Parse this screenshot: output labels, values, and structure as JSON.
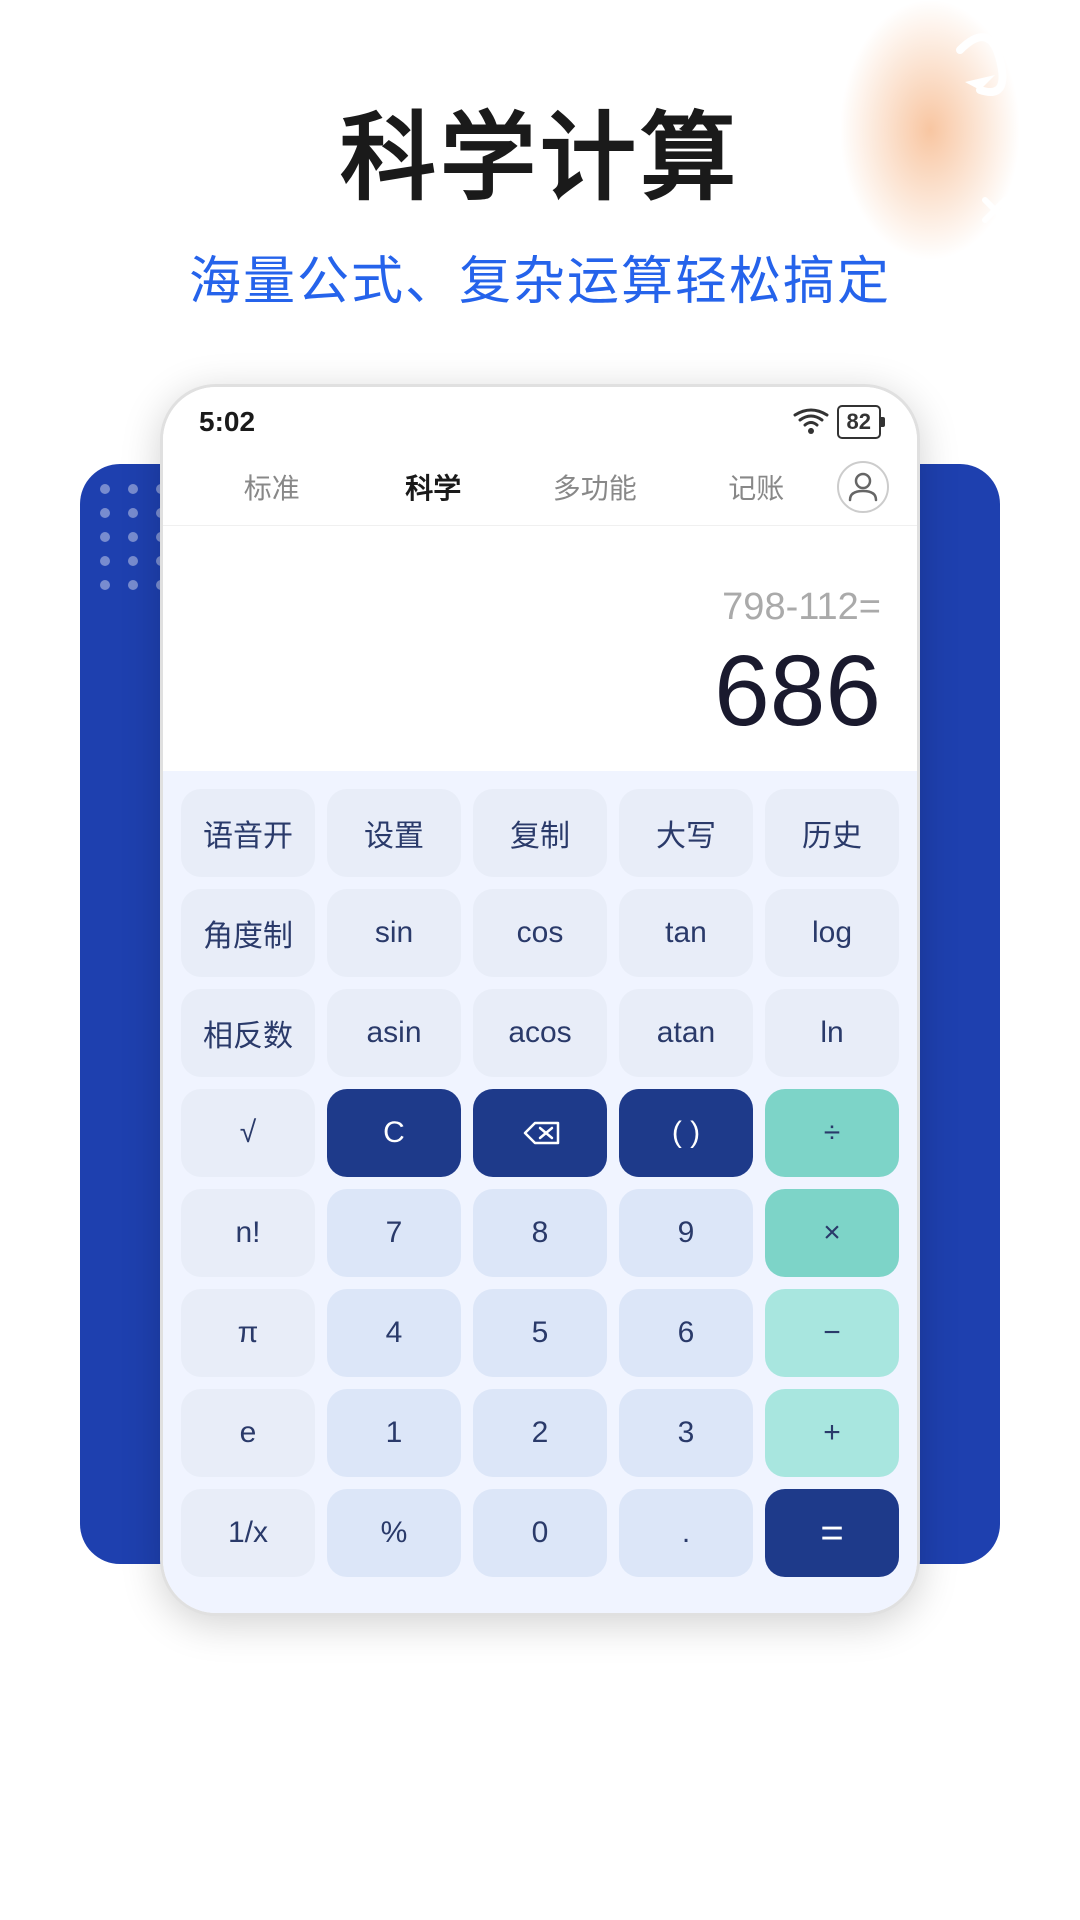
{
  "page": {
    "title": "科学计算",
    "subtitle": "海量公式、复杂运算轻松搞定"
  },
  "status_bar": {
    "time": "5:02",
    "battery": "82"
  },
  "nav": {
    "tabs": [
      "标准",
      "科学",
      "多功能",
      "记账"
    ],
    "active_tab": "科学"
  },
  "display": {
    "expression": "798-112=",
    "result": "686"
  },
  "keyboard": {
    "row1": [
      "语音开",
      "设置",
      "复制",
      "大写",
      "历史"
    ],
    "row2": [
      "角度制",
      "sin",
      "cos",
      "tan",
      "log"
    ],
    "row3": [
      "相反数",
      "asin",
      "acos",
      "atan",
      "ln"
    ],
    "row4": [
      "√",
      "C",
      "⌫",
      "( )",
      "÷"
    ],
    "row5": [
      "n!",
      "7",
      "8",
      "9",
      "×"
    ],
    "row6": [
      "π",
      "4",
      "5",
      "6",
      "−"
    ],
    "row7": [
      "e",
      "1",
      "2",
      "3",
      "+"
    ],
    "row8": [
      "1/x",
      "%",
      "0",
      ".",
      "="
    ]
  }
}
